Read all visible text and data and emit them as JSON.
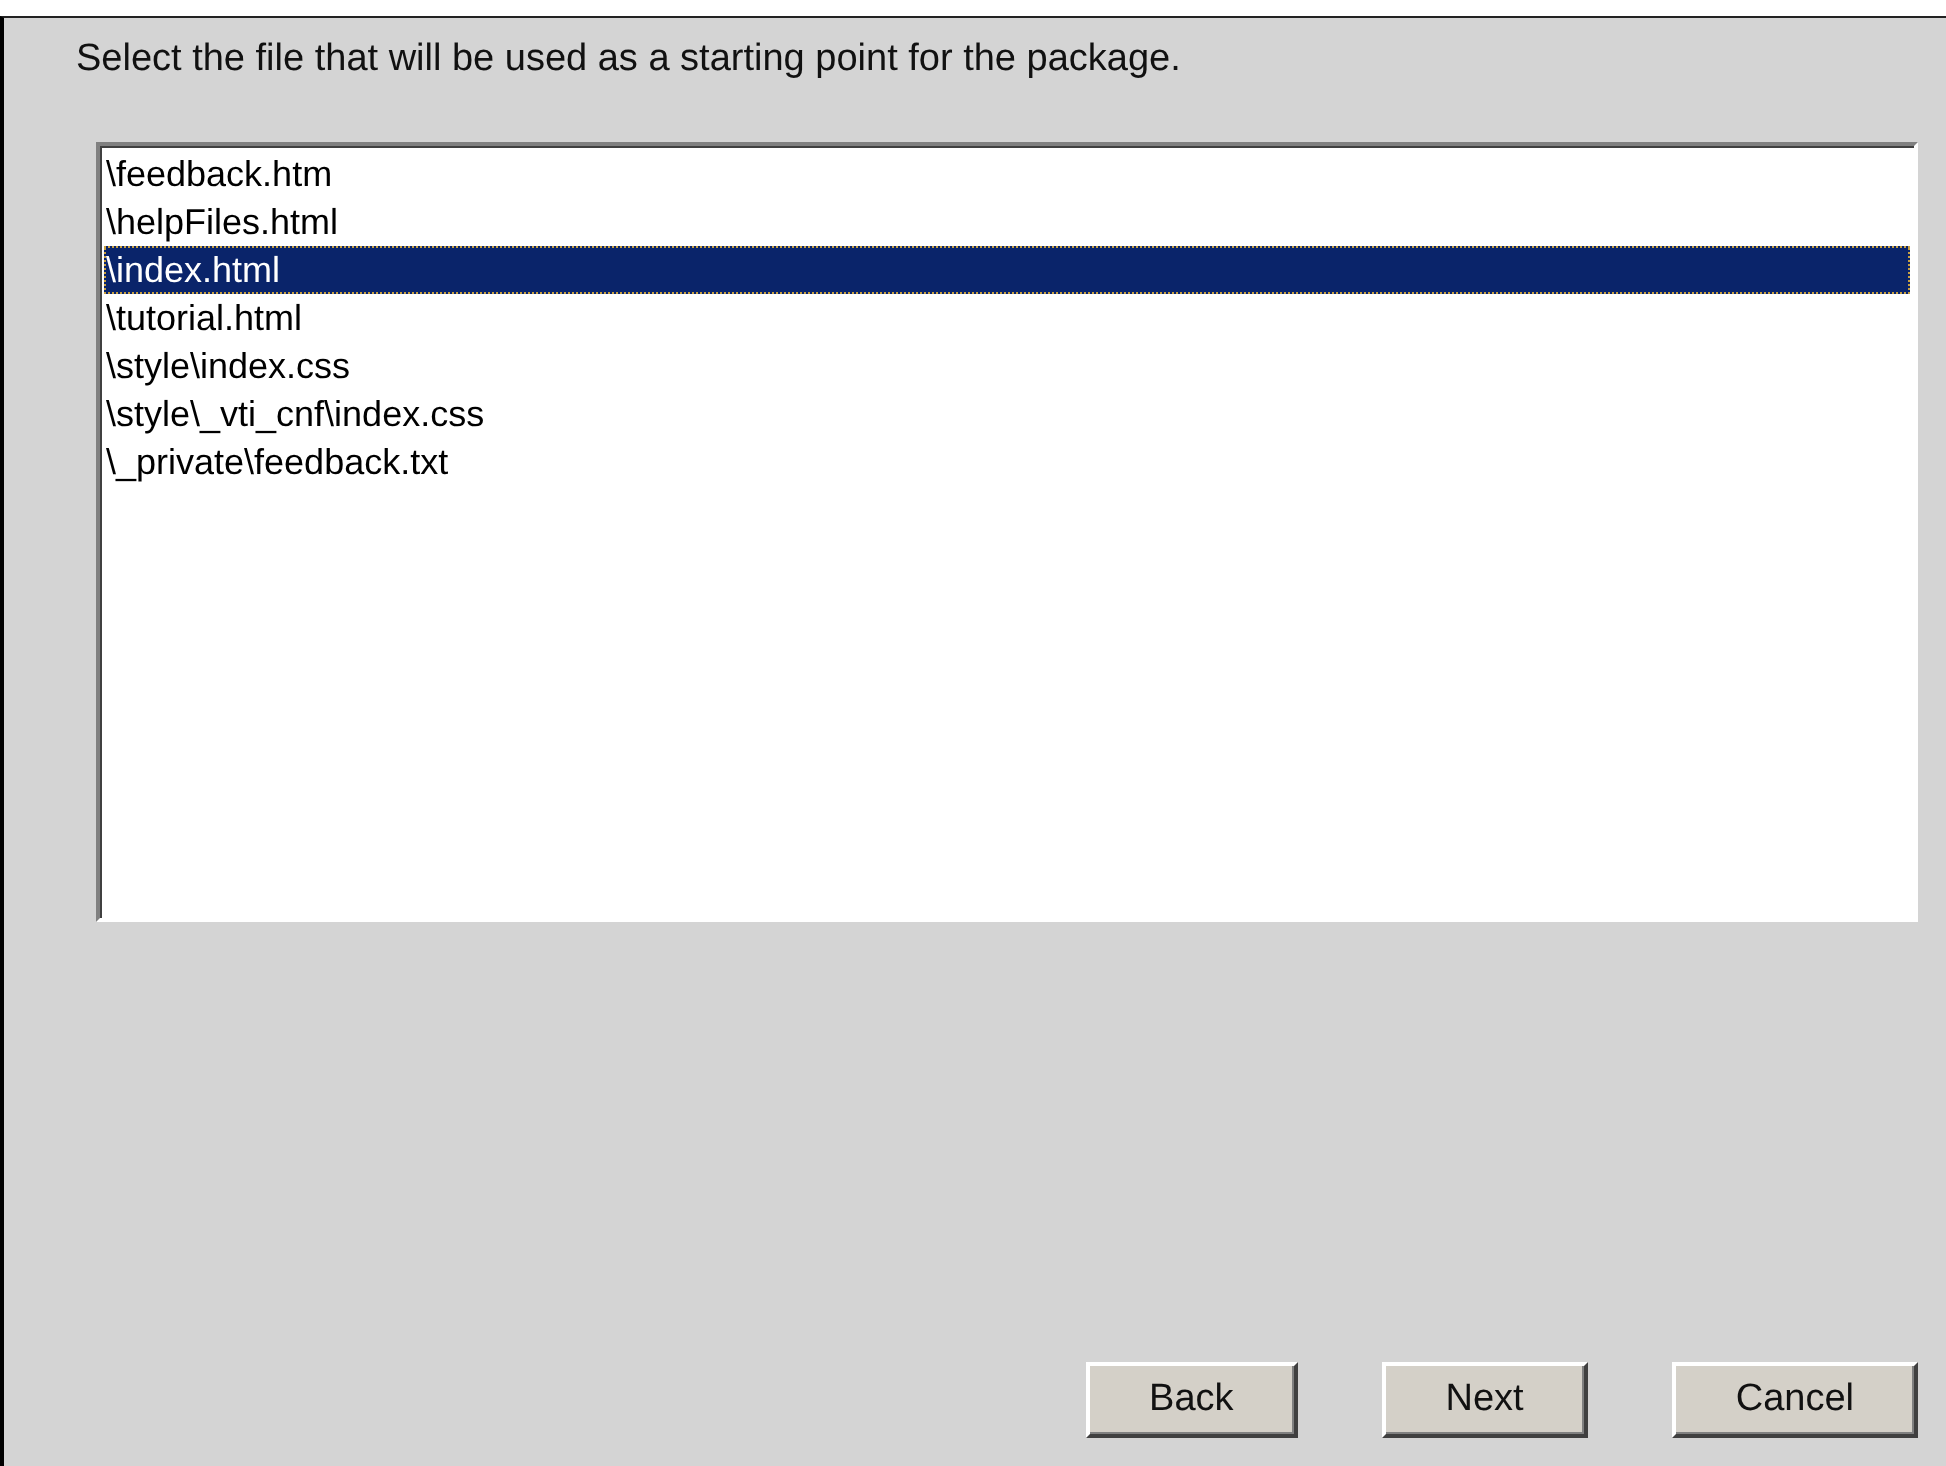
{
  "instruction": "Select the file that will be used as a starting point for the package.",
  "files": [
    {
      "label": "\\feedback.htm",
      "selected": false
    },
    {
      "label": "\\helpFiles.html",
      "selected": false
    },
    {
      "label": "\\index.html",
      "selected": true
    },
    {
      "label": "\\tutorial.html",
      "selected": false
    },
    {
      "label": "\\style\\index.css",
      "selected": false
    },
    {
      "label": "\\style\\_vti_cnf\\index.css",
      "selected": false
    },
    {
      "label": "\\_private\\feedback.txt",
      "selected": false
    }
  ],
  "buttons": [
    "Back",
    "Next",
    "Cancel"
  ]
}
